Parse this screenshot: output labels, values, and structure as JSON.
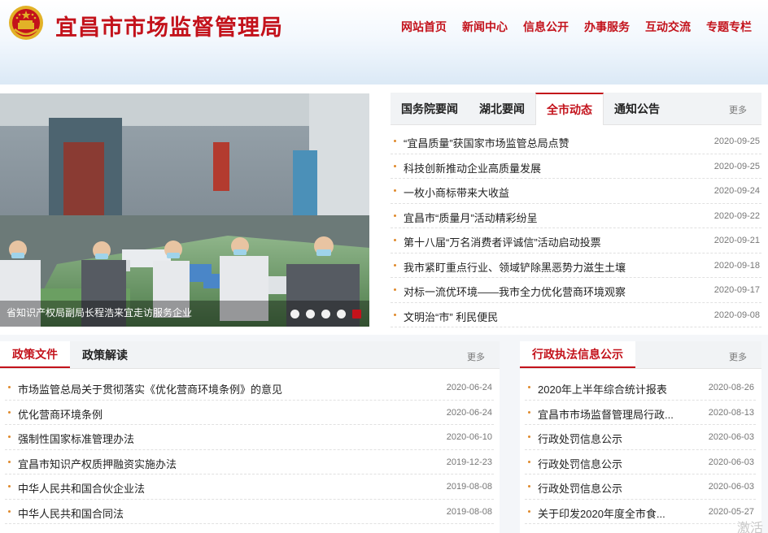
{
  "site": {
    "title": "宜昌市市场监督管理局",
    "brand_color": "#c3121b"
  },
  "nav": [
    {
      "label": "网站首页"
    },
    {
      "label": "新闻中心"
    },
    {
      "label": "信息公开"
    },
    {
      "label": "办事服务"
    },
    {
      "label": "互动交流"
    },
    {
      "label": "专题专栏"
    }
  ],
  "slider": {
    "caption": "省知识产权局副局长程浩来宜走访服务企业",
    "slide_count": 5,
    "active_slide": 5
  },
  "news": {
    "tabs": [
      {
        "label": "国务院要闻",
        "active": false
      },
      {
        "label": "湖北要闻",
        "active": false
      },
      {
        "label": "全市动态",
        "active": true
      },
      {
        "label": "通知公告",
        "active": false
      }
    ],
    "more": "更多",
    "items": [
      {
        "title": "“宜昌质量”获国家市场监管总局点赞",
        "date": "2020-09-25"
      },
      {
        "title": "科技创新推动企业高质量发展",
        "date": "2020-09-25"
      },
      {
        "title": "一枚小商标带来大收益",
        "date": "2020-09-24"
      },
      {
        "title": "宜昌市“质量月”活动精彩纷呈",
        "date": "2020-09-22"
      },
      {
        "title": "第十八届“万名消费者评诚信”活动启动投票",
        "date": "2020-09-21"
      },
      {
        "title": "我市紧盯重点行业、领域铲除黑恶势力滋生土壤",
        "date": "2020-09-18"
      },
      {
        "title": "对标一流优环境——我市全力优化营商环境观察",
        "date": "2020-09-17"
      },
      {
        "title": "文明治“市” 利民便民",
        "date": "2020-09-08"
      }
    ]
  },
  "policy": {
    "tabs": [
      {
        "label": "政策文件",
        "active": true
      },
      {
        "label": "政策解读",
        "active": false
      }
    ],
    "more": "更多",
    "items": [
      {
        "title": "市场监管总局关于贯彻落实《优化营商环境条例》的意见",
        "date": "2020-06-24"
      },
      {
        "title": "优化营商环境条例",
        "date": "2020-06-24"
      },
      {
        "title": "强制性国家标准管理办法",
        "date": "2020-06-10"
      },
      {
        "title": "宜昌市知识产权质押融资实施办法",
        "date": "2019-12-23"
      },
      {
        "title": "中华人民共和国合伙企业法",
        "date": "2019-08-08"
      },
      {
        "title": "中华人民共和国合同法",
        "date": "2019-08-08"
      }
    ]
  },
  "enforcement": {
    "tab": "行政执法信息公示",
    "more": "更多",
    "items": [
      {
        "title": "2020年上半年综合统计报表",
        "date": "2020-08-26"
      },
      {
        "title": "宜昌市市场监督管理局行政...",
        "date": "2020-08-13"
      },
      {
        "title": "行政处罚信息公示",
        "date": "2020-06-03"
      },
      {
        "title": "行政处罚信息公示",
        "date": "2020-06-03"
      },
      {
        "title": "行政处罚信息公示",
        "date": "2020-06-03"
      },
      {
        "title": "关于印发2020年度全市食...",
        "date": "2020-05-27"
      }
    ]
  },
  "watermark": "激活"
}
